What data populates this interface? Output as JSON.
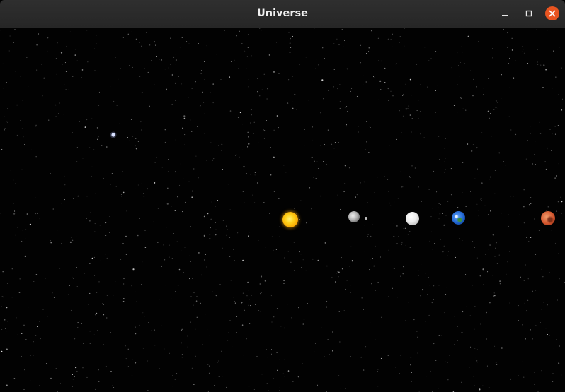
{
  "window": {
    "title": "Universe",
    "buttons": {
      "minimize_icon": "minimize-icon",
      "maximize_icon": "maximize-icon",
      "close_icon": "close-icon"
    },
    "close_color": "#e95420"
  },
  "scene": {
    "background_color": "#020202",
    "bodies": [
      {
        "name": "sun",
        "color": "#ffd21a"
      },
      {
        "name": "mercury",
        "color": "#b8b8b8"
      },
      {
        "name": "moonlet",
        "color": "#bdbdbd"
      },
      {
        "name": "venus",
        "color": "#ececec"
      },
      {
        "name": "earth",
        "color": "#1b5ec9"
      },
      {
        "name": "mars",
        "color": "#d2562e"
      }
    ]
  }
}
